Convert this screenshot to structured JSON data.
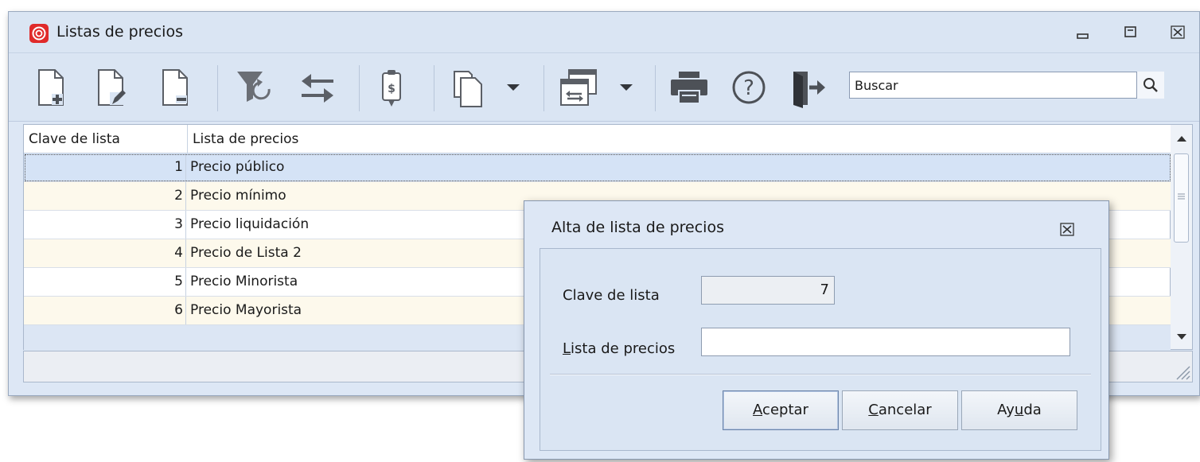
{
  "window": {
    "title": "Listas de precios"
  },
  "search": {
    "placeholder": "Buscar"
  },
  "toolbar": {
    "icons": [
      "new-document-icon",
      "edit-document-icon",
      "delete-document-icon",
      "filter-refresh-icon",
      "swap-arrows-icon",
      "price-document-icon",
      "copy-icon",
      "dropdown-arrow-icon",
      "window-transfer-icon",
      "dropdown-arrow-icon",
      "print-icon",
      "help-icon",
      "exit-icon"
    ]
  },
  "grid": {
    "columns": [
      "Clave de lista",
      "Lista de precios"
    ],
    "rows": [
      {
        "clave": "1",
        "lista": "Precio público"
      },
      {
        "clave": "2",
        "lista": "Precio mínimo"
      },
      {
        "clave": "3",
        "lista": "Precio liquidación"
      },
      {
        "clave": "4",
        "lista": "Precio de Lista 2"
      },
      {
        "clave": "5",
        "lista": "Precio Minorista"
      },
      {
        "clave": "6",
        "lista": "Precio Mayorista"
      }
    ],
    "selected_row": 0
  },
  "dialog": {
    "title": "Alta de lista de precios",
    "clave_label": "Clave de lista",
    "clave_value": "7",
    "lista_label_ul": "L",
    "lista_label_rest": "ista de precios",
    "lista_value": "",
    "buttons": {
      "aceptar_ul": "A",
      "aceptar_rest": "ceptar",
      "cancelar_ul": "C",
      "cancelar_rest": "ancelar",
      "ayuda_pre": "Ay",
      "ayuda_ul": "u",
      "ayuda_rest": "da"
    }
  },
  "colors": {
    "chrome": "#dae5f3",
    "row_alt": "#fdf9ec",
    "row_selected": "#d5e3f6",
    "icon_gray": "#5b5f66",
    "app_icon_red": "#e02a2a"
  }
}
